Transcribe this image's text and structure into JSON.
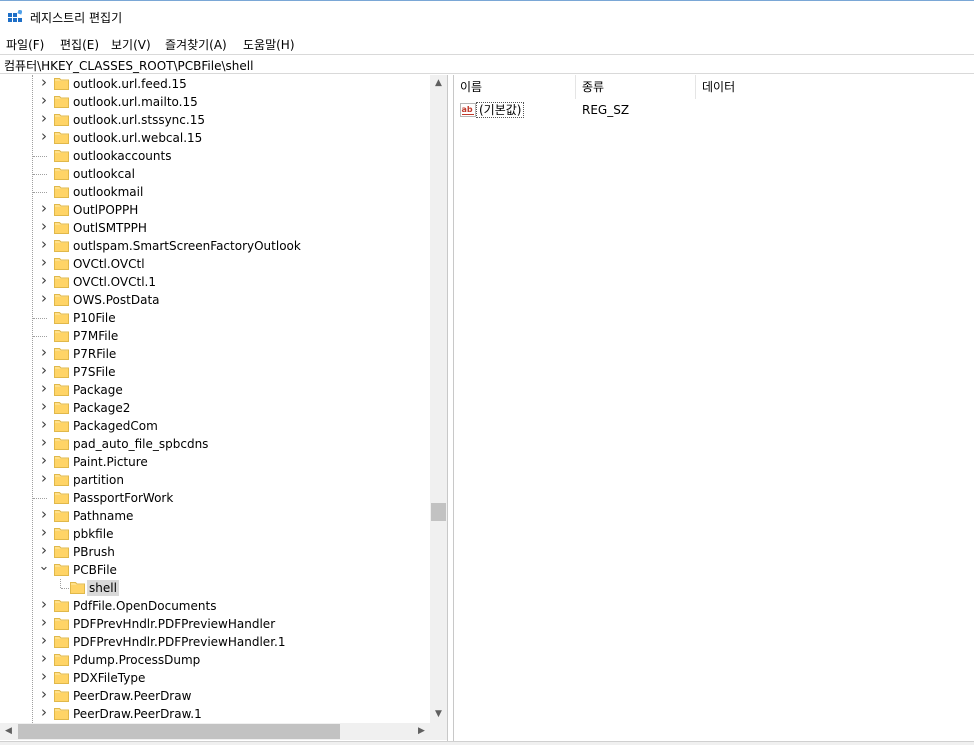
{
  "window": {
    "title": "레지스트리 편집기",
    "icon": "registry-editor-icon"
  },
  "menu": [
    "파일(F)",
    "편집(E)",
    "보기(V)",
    "즐겨찾기(A)",
    "도움말(H)"
  ],
  "address": "컴퓨터\\HKEY_CLASSES_ROOT\\PCBFile\\shell",
  "tree": {
    "items": [
      {
        "label": "outlook.url.feed.15",
        "expandable": true
      },
      {
        "label": "outlook.url.mailto.15",
        "expandable": true
      },
      {
        "label": "outlook.url.stssync.15",
        "expandable": true
      },
      {
        "label": "outlook.url.webcal.15",
        "expandable": true
      },
      {
        "label": "outlookaccounts",
        "expandable": false
      },
      {
        "label": "outlookcal",
        "expandable": false
      },
      {
        "label": "outlookmail",
        "expandable": false
      },
      {
        "label": "OutlPOPPH",
        "expandable": true
      },
      {
        "label": "OutlSMTPPH",
        "expandable": true
      },
      {
        "label": "outlspam.SmartScreenFactoryOutlook",
        "expandable": true
      },
      {
        "label": "OVCtl.OVCtl",
        "expandable": true
      },
      {
        "label": "OVCtl.OVCtl.1",
        "expandable": true
      },
      {
        "label": "OWS.PostData",
        "expandable": true
      },
      {
        "label": "P10File",
        "expandable": false
      },
      {
        "label": "P7MFile",
        "expandable": false
      },
      {
        "label": "P7RFile",
        "expandable": true
      },
      {
        "label": "P7SFile",
        "expandable": true
      },
      {
        "label": "Package",
        "expandable": true
      },
      {
        "label": "Package2",
        "expandable": true
      },
      {
        "label": "PackagedCom",
        "expandable": true
      },
      {
        "label": "pad_auto_file_spbcdns",
        "expandable": true
      },
      {
        "label": "Paint.Picture",
        "expandable": true
      },
      {
        "label": "partition",
        "expandable": true
      },
      {
        "label": "PassportForWork",
        "expandable": false
      },
      {
        "label": "Pathname",
        "expandable": true
      },
      {
        "label": "pbkfile",
        "expandable": true
      },
      {
        "label": "PBrush",
        "expandable": true
      },
      {
        "label": "PCBFile",
        "expandable": true,
        "expanded": true
      },
      {
        "label": "shell",
        "expandable": false,
        "child": true,
        "selected": true
      },
      {
        "label": "PdfFile.OpenDocuments",
        "expandable": true
      },
      {
        "label": "PDFPrevHndlr.PDFPreviewHandler",
        "expandable": true
      },
      {
        "label": "PDFPrevHndlr.PDFPreviewHandler.1",
        "expandable": true
      },
      {
        "label": "Pdump.ProcessDump",
        "expandable": true
      },
      {
        "label": "PDXFileType",
        "expandable": true
      },
      {
        "label": "PeerDraw.PeerDraw",
        "expandable": true
      },
      {
        "label": "PeerDraw.PeerDraw.1",
        "expandable": true
      }
    ]
  },
  "values": {
    "columns": [
      "이름",
      "종류",
      "데이터"
    ],
    "rows": [
      {
        "name": "(기본값)",
        "type": "REG_SZ",
        "data": "",
        "icon": "string-value-icon"
      }
    ]
  }
}
